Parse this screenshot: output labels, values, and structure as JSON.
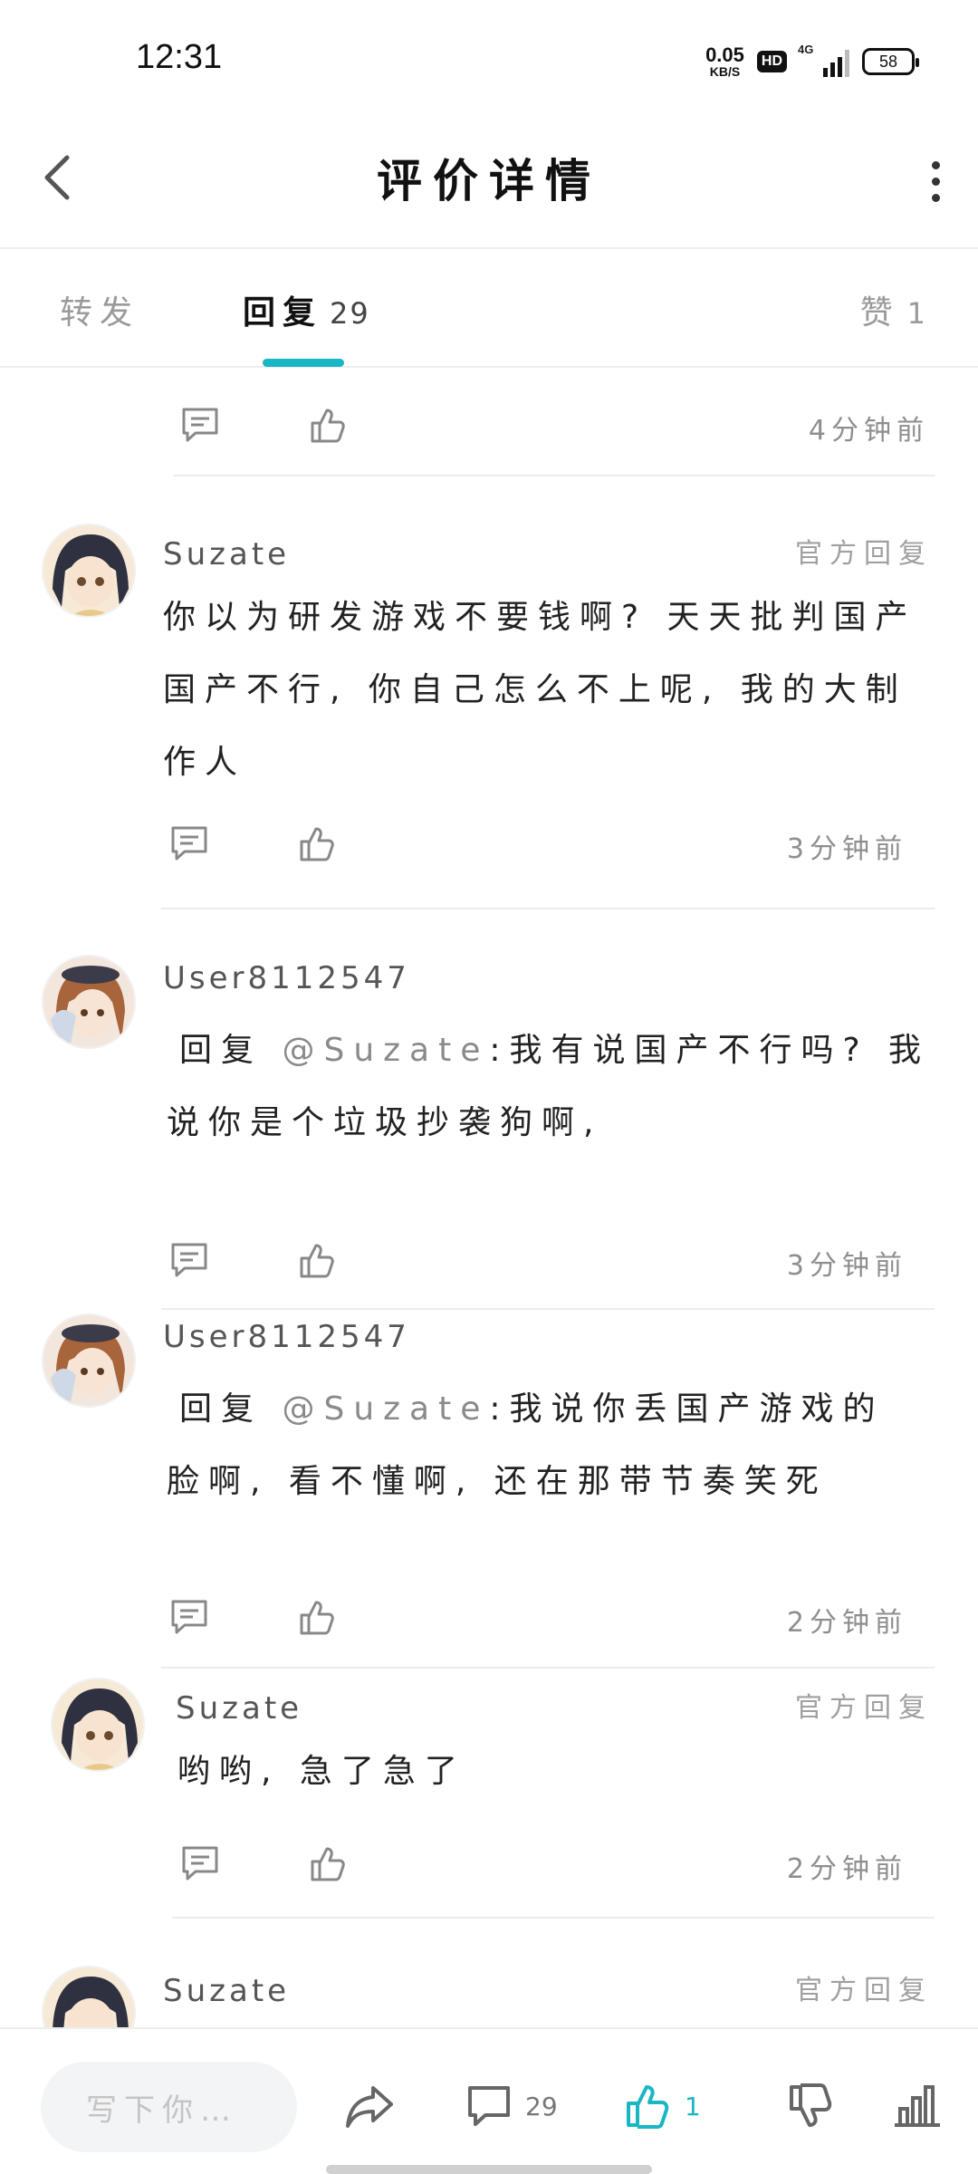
{
  "status_bar": {
    "time": "12:31",
    "net_speed_value": "0.05",
    "net_speed_unit": "KB/S",
    "hd": "HD",
    "signal": "4G",
    "battery": "58"
  },
  "header": {
    "title": "评价详情"
  },
  "tabs": {
    "repost_label": "转发",
    "reply_label": "回复",
    "reply_count": "29",
    "like_label": "赞",
    "like_count": "1"
  },
  "replies": [
    {
      "time": "4分钟前"
    },
    {
      "username": "Suzate",
      "official": "官方回复",
      "content": "你以为研发游戏不要钱啊? 天天批判国产国产不行, 你自己怎么不上呢, 我的大制作人",
      "time": "3分钟前"
    },
    {
      "username": "User8112547",
      "reply_prefix": "回复",
      "mention": "@Suzate",
      "content": ":我有说国产不行吗? 我说你是个垃圾抄袭狗啊,",
      "time": "3分钟前"
    },
    {
      "username": "User8112547",
      "reply_prefix": "回复",
      "mention": "@Suzate",
      "content": ":我说你丢国产游戏的脸啊, 看不懂啊, 还在那带节奏笑死",
      "time": "2分钟前"
    },
    {
      "username": "Suzate",
      "official": "官方回复",
      "content": "哟哟, 急了急了",
      "time": "2分钟前"
    },
    {
      "username": "Suzate",
      "official": "官方回复"
    }
  ],
  "bottom_bar": {
    "input_placeholder": "写下你…",
    "comment_count": "29",
    "like_count": "1"
  },
  "colors": {
    "accent": "#19b6c4"
  }
}
